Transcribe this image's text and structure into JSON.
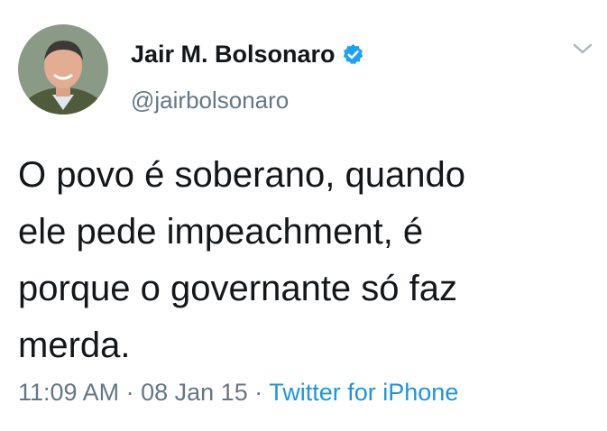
{
  "user": {
    "display_name": "Jair M. Bolsonaro",
    "handle": "@jairbolsonaro",
    "verified": true
  },
  "tweet": {
    "text": "O povo é soberano, quando\nele pede impeachment, é\nporque o governante só faz\nmerda.",
    "time": "11:09 AM",
    "separator": "·",
    "date": "08 Jan 15",
    "source": "Twitter for iPhone"
  },
  "icons": {
    "verified": "verified-badge-icon",
    "menu": "chevron-down-icon"
  },
  "colors": {
    "text": "#14171a",
    "secondary": "#657786",
    "link": "#1b95e0",
    "verified": "#1da1f2"
  }
}
